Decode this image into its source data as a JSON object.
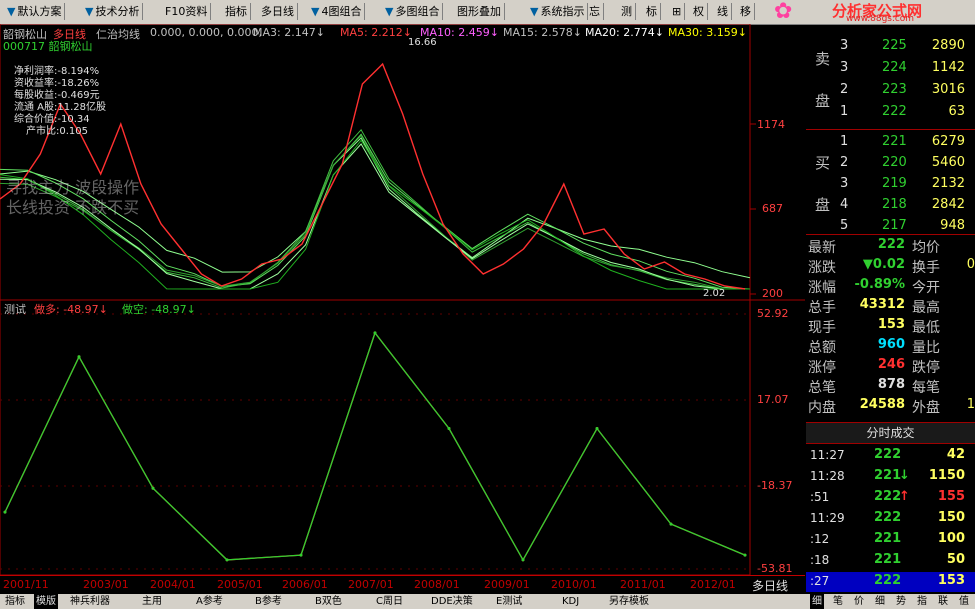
{
  "toolbar": {
    "items": [
      {
        "label": "默认方案",
        "arrow": true
      },
      {
        "label": "技术分析",
        "arrow": true
      },
      {
        "label": "F10资料",
        "arrow": false
      },
      {
        "label": "指标",
        "arrow": false
      },
      {
        "label": "多日线",
        "arrow": false
      },
      {
        "label": "4图组合",
        "arrow": true
      },
      {
        "label": "多图组合",
        "arrow": true
      },
      {
        "label": "图形叠加",
        "arrow": false
      },
      {
        "label": "系统指示",
        "arrow": true
      },
      {
        "label": "忘",
        "arrow": false
      },
      {
        "label": "测",
        "arrow": false
      },
      {
        "label": "标",
        "arrow": false
      },
      {
        "label": "⊞",
        "arrow": false
      },
      {
        "label": "权",
        "arrow": false
      },
      {
        "label": "线",
        "arrow": false
      },
      {
        "label": "移",
        "arrow": false
      }
    ],
    "logo_text": "分析家公式网",
    "logo_url": "www.88gs.com"
  },
  "main_header": {
    "stock": "韶钢松山",
    "period": "多日线",
    "indicator": "仁治均线",
    "values": "0.000, 0.000, 0.000,",
    "ma3": "MA3: 2.147↓",
    "ma5": "MA5: 2.212↓",
    "ma10": "MA10: 2.459↓",
    "ma15": "MA15: 2.578↓",
    "ma20": "MA20: 2.774↓",
    "ma30": "MA30: 3.159↓",
    "code_line": "000717 韶钢松山"
  },
  "fundamentals": [
    "净利润率:-8.194%",
    "资收益率:-18.26%",
    "每股收益:-0.469元",
    "流通 A股:11.28亿股",
    "综合价值:-10.34",
    "产市比:0.105"
  ],
  "watermark": [
    "寻找主力 波段操作",
    "长线投资 不跌不买"
  ],
  "price_axis": {
    "labels": [
      "1174",
      "687",
      "200"
    ],
    "peak": "16.66",
    "low": "2.02"
  },
  "sub_header": {
    "name": "测试",
    "buy": "做多: -48.97↓",
    "sell": "做空: -48.97↓"
  },
  "sub_axis": {
    "labels": [
      "52.92",
      "17.07",
      "-18.37",
      "-53.81"
    ]
  },
  "dates": [
    "2001/11",
    "2003/01",
    "2004/01",
    "2005/01",
    "2006/01",
    "2007/01",
    "2008/01",
    "2009/01",
    "2010/01",
    "2011/01",
    "2012/01"
  ],
  "period_label": "多日线",
  "order_book": {
    "sell": [
      {
        "lvl": "3",
        "price": "225",
        "vol": "2890"
      },
      {
        "lvl": "3",
        "price": "224",
        "vol": "1142"
      },
      {
        "lvl": "2",
        "price": "223",
        "vol": "3016"
      },
      {
        "lvl": "1",
        "price": "222",
        "vol": "63"
      }
    ],
    "buy": [
      {
        "lvl": "1",
        "price": "221",
        "vol": "6279"
      },
      {
        "lvl": "2",
        "price": "220",
        "vol": "5460"
      },
      {
        "lvl": "3",
        "price": "219",
        "vol": "2132"
      },
      {
        "lvl": "4",
        "price": "218",
        "vol": "2842"
      },
      {
        "lvl": "5",
        "price": "217",
        "vol": "948"
      }
    ],
    "sell_label": [
      "卖",
      "盘"
    ],
    "buy_label": [
      "买",
      "盘"
    ]
  },
  "stats": [
    {
      "k": "最新",
      "v": "222",
      "k2": "均价",
      "v2": ""
    },
    {
      "k": "涨跌",
      "v": "▼0.02",
      "k2": "换手",
      "v2": "0"
    },
    {
      "k": "涨幅",
      "v": "-0.89%",
      "k2": "今开",
      "v2": ""
    },
    {
      "k": "总手",
      "v": "43312",
      "k2": "最高",
      "v2": ""
    },
    {
      "k": "现手",
      "v": "153",
      "k2": "最低",
      "v2": ""
    },
    {
      "k": "总额",
      "v": "960",
      "k2": "量比",
      "v2": ""
    },
    {
      "k": "涨停",
      "v": "246",
      "k2": "跌停",
      "v2": ""
    },
    {
      "k": "总笔",
      "v": "878",
      "k2": "每笔",
      "v2": ""
    },
    {
      "k": "内盘",
      "v": "24588",
      "k2": "外盘",
      "v2": "1"
    }
  ],
  "ticks_title": "分时成交",
  "ticks": [
    {
      "t": "11:27",
      "p": "222",
      "arrow": "",
      "v": "42"
    },
    {
      "t": "11:28",
      "p": "221",
      "arrow": "↓",
      "v": "1150"
    },
    {
      "t": ":51",
      "p": "222",
      "arrow": "↑",
      "v": "155"
    },
    {
      "t": "11:29",
      "p": "222",
      "arrow": "",
      "v": "150"
    },
    {
      "t": ":12",
      "p": "221",
      "arrow": "",
      "v": "100"
    },
    {
      "t": ":18",
      "p": "221",
      "arrow": "",
      "v": "50"
    },
    {
      "t": ":27",
      "p": "222",
      "arrow": "",
      "v": "153"
    }
  ],
  "tabs": [
    "指标",
    "模版",
    "神兵利器",
    "主用",
    "A参考",
    "B参考",
    "B双色",
    "C周日",
    "DDE决策",
    "E测试",
    "KDJ",
    "另存模板"
  ],
  "right_tabs": [
    "细",
    "笔",
    "价",
    "细",
    "势",
    "指",
    "联",
    "值"
  ],
  "chart_data": {
    "type": "line",
    "title": "",
    "x": [
      "2001/11",
      "2003/01",
      "2004/01",
      "2005/01",
      "2006/01",
      "2007/01",
      "2008/01",
      "2009/01",
      "2010/01",
      "2011/01",
      "2012/01"
    ],
    "series": [
      {
        "name": "做多",
        "values": [
          -30,
          35,
          -20,
          -50,
          -48,
          45,
          5,
          -50,
          5,
          -35,
          -48
        ]
      },
      {
        "name": "做空",
        "values": [
          -30,
          35,
          -20,
          -50,
          -48,
          45,
          5,
          -50,
          5,
          -35,
          -48
        ]
      }
    ],
    "ylim": [
      -53.81,
      52.92
    ],
    "xlabel": "",
    "ylabel": ""
  },
  "colors": {
    "red": "#ff3030",
    "green": "#30d030",
    "yellow": "#ffff00",
    "cyan": "#00ffff",
    "grid": "#a00000"
  }
}
